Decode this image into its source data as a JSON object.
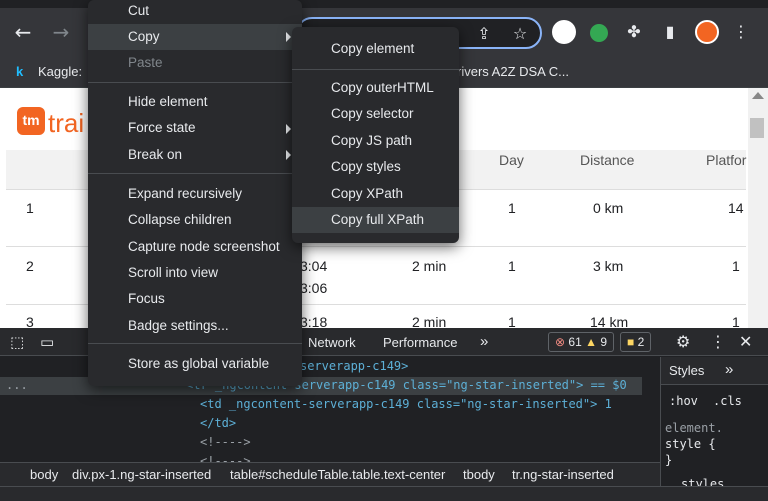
{
  "bookmarks": {
    "kaggle": "Kaggle:",
    "striver": "rivers A2Z DSA C..."
  },
  "page": {
    "logo_text": "trai",
    "table_headers": [
      "Day",
      "Distance",
      "Platfor"
    ],
    "rows": [
      {
        "num": "1",
        "time1": "",
        "time2": "",
        "halt": "",
        "day": "1",
        "distance": "0 km",
        "platform": "14"
      },
      {
        "num": "2",
        "time1": "3:04",
        "time2": "3:06",
        "halt": "2 min",
        "day": "1",
        "distance": "3 km",
        "platform": "1"
      },
      {
        "num": "3",
        "time1": "3:18",
        "time2": "",
        "halt": "2 min",
        "day": "1",
        "distance": "14 km",
        "platform": "1"
      }
    ]
  },
  "devtools": {
    "tabs": {
      "network": "Network",
      "performance": "Performance",
      "more": "»"
    },
    "errors": "61",
    "warnings": "9",
    "issues": "2",
    "styles_tab": "Styles",
    "styles_more": "»",
    "hov": ":hov",
    "cls": ".cls",
    "element_style_1": "element.",
    "element_style_2": "style {",
    "element_style_3": "}",
    "styles_bottom": "styles...",
    "code_lines": [
      "serverapp-c149>",
      "<tr _ngcontent-serverapp-c149 class=\"ng-star-inserted\"> == $0",
      "<td _ngcontent-serverapp-c149 class=\"ng-star-inserted\"> 1",
      "</td>",
      "<!---->",
      "<!---->"
    ],
    "breadcrumbs": [
      "body",
      "div.px-1.ng-star-inserted",
      "table#scheduleTable.table.text-center",
      "tbody",
      "tr.ng-star-inserted"
    ],
    "dots": "..."
  },
  "context_menu": {
    "items": [
      "Cut",
      "Copy",
      "Paste",
      "Hide element",
      "Force state",
      "Break on",
      "Expand recursively",
      "Collapse children",
      "Capture node screenshot",
      "Scroll into view",
      "Focus",
      "Badge settings...",
      "Store as global variable"
    ]
  },
  "copy_submenu": {
    "items": [
      "Copy element",
      "Copy outerHTML",
      "Copy selector",
      "Copy JS path",
      "Copy styles",
      "Copy XPath",
      "Copy full XPath"
    ]
  },
  "colors": {
    "accent": "#8ab4f8",
    "brand": "#f26522",
    "error": "#f28b82",
    "warning": "#fdd663"
  }
}
